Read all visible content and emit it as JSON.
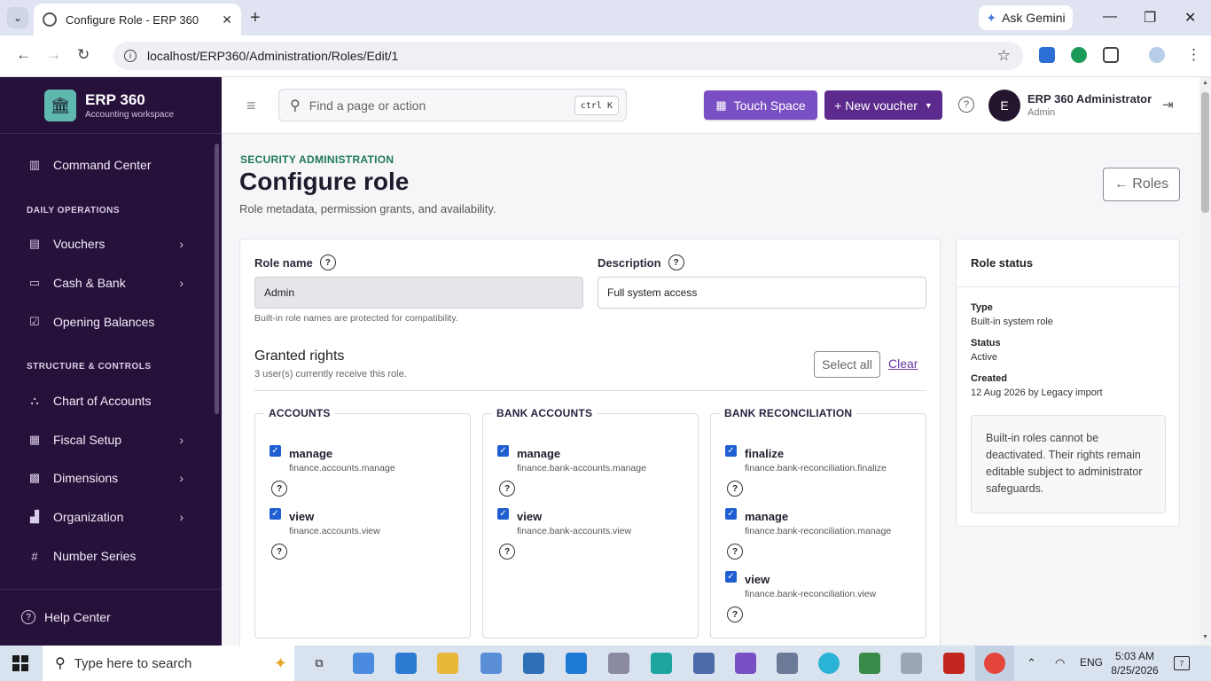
{
  "browser": {
    "tab_title": "Configure Role - ERP 360",
    "url": "localhost/ERP360/Administration/Roles/Edit/1",
    "ask_gemini": "Ask Gemini"
  },
  "brand": {
    "name": "ERP 360",
    "subtitle": "Accounting workspace"
  },
  "sidebar": {
    "command_center": "Command Center",
    "section_daily": "DAILY OPERATIONS",
    "vouchers": "Vouchers",
    "cash_bank": "Cash & Bank",
    "opening_balances": "Opening Balances",
    "section_structure": "STRUCTURE & CONTROLS",
    "chart_of_accounts": "Chart of Accounts",
    "fiscal_setup": "Fiscal Setup",
    "dimensions": "Dimensions",
    "organization": "Organization",
    "number_series": "Number Series",
    "help_center": "Help Center"
  },
  "header": {
    "search_placeholder": "Find a page or action",
    "shortcut": "ctrl K",
    "touch_space": "Touch Space",
    "new_voucher": "+ New voucher",
    "avatar_initial": "E",
    "user_name": "ERP 360 Administrator",
    "user_role": "Admin"
  },
  "page": {
    "eyebrow": "SECURITY ADMINISTRATION",
    "title": "Configure role",
    "subtitle": "Role metadata, permission grants, and availability.",
    "back_button": "← Roles"
  },
  "form": {
    "role_name_label": "Role name",
    "role_name_value": "Admin",
    "role_name_help": "Built-in role names are protected for compatibility.",
    "description_label": "Description",
    "description_value": "Full system access"
  },
  "rights": {
    "title": "Granted rights",
    "subtitle": "3 user(s) currently receive this role.",
    "select_all": "Select all",
    "clear": "Clear",
    "groups": [
      {
        "name": "ACCOUNTS",
        "perms": [
          {
            "name": "manage",
            "key": "finance.accounts.manage"
          },
          {
            "name": "view",
            "key": "finance.accounts.view"
          }
        ]
      },
      {
        "name": "BANK ACCOUNTS",
        "perms": [
          {
            "name": "manage",
            "key": "finance.bank-accounts.manage"
          },
          {
            "name": "view",
            "key": "finance.bank-accounts.view"
          }
        ]
      },
      {
        "name": "BANK RECONCILIATION",
        "perms": [
          {
            "name": "finalize",
            "key": "finance.bank-reconciliation.finalize"
          },
          {
            "name": "manage",
            "key": "finance.bank-reconciliation.manage"
          },
          {
            "name": "view",
            "key": "finance.bank-reconciliation.view"
          }
        ]
      }
    ]
  },
  "status": {
    "title": "Role status",
    "type_label": "Type",
    "type_value": "Built-in system role",
    "status_label": "Status",
    "status_value": "Active",
    "created_label": "Created",
    "created_value": "12 Aug 2026 by Legacy import",
    "note": "Built-in roles cannot be deactivated. Their rights remain editable subject to administrator safeguards."
  },
  "taskbar": {
    "search_placeholder": "Type here to search",
    "lang": "ENG",
    "time": "5:03 AM",
    "date": "8/25/2026",
    "notifications": "7"
  },
  "colors": {
    "sidebar_bg": "#26113b",
    "accent_purple": "#5b2a8c",
    "touch_purple": "#7a4fc4",
    "eyebrow_green": "#1f7a57",
    "checkbox_blue": "#1f5fd1"
  }
}
